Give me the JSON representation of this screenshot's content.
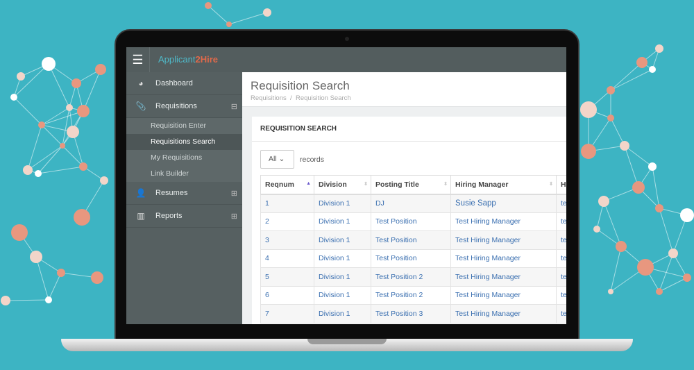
{
  "colors": {
    "background": "#3db4c3",
    "node": "#e8977f",
    "sidebar": "#566061",
    "link": "#3a6fb0"
  },
  "app": {
    "logo_a": "Applicant",
    "logo_b": "2Hire",
    "menu_icon": "hamburger-icon"
  },
  "sidebar": {
    "items": [
      {
        "label": "Dashboard",
        "icon": "dashboard-icon"
      },
      {
        "label": "Requisitions",
        "icon": "paperclip-icon",
        "toggle": "⊟"
      },
      {
        "label": "Resumes",
        "icon": "user-icon",
        "toggle": "⊞"
      },
      {
        "label": "Reports",
        "icon": "bar-chart-icon",
        "toggle": "⊞"
      }
    ],
    "subitems": [
      "Requisition Enter",
      "Requisitions Search",
      "My Requisitions",
      "Link Builder"
    ]
  },
  "page": {
    "title": "Requisition Search",
    "breadcrumb": [
      "Requisitions",
      "/",
      "Requisition Search"
    ]
  },
  "panel": {
    "title": "REQUISITION SEARCH",
    "length_value": "All",
    "length_suffix": "records"
  },
  "table": {
    "headers": [
      "Reqnum",
      "Division",
      "Posting Title",
      "Hiring Manager",
      "H"
    ],
    "rows": [
      [
        "1",
        "Division 1",
        "DJ",
        "Susie Sapp",
        "te"
      ],
      [
        "2",
        "Division 1",
        "Test Position",
        "Test Hiring Manager",
        "te"
      ],
      [
        "3",
        "Division 1",
        "Test Position",
        "Test Hiring Manager",
        "te"
      ],
      [
        "4",
        "Division 1",
        "Test Position",
        "Test Hiring Manager",
        "te"
      ],
      [
        "5",
        "Division 1",
        "Test Position 2",
        "Test Hiring Manager",
        "te"
      ],
      [
        "6",
        "Division 1",
        "Test Position 2",
        "Test Hiring Manager",
        "te"
      ],
      [
        "7",
        "Division 1",
        "Test Position 3",
        "Test Hiring Manager",
        "te"
      ]
    ]
  }
}
